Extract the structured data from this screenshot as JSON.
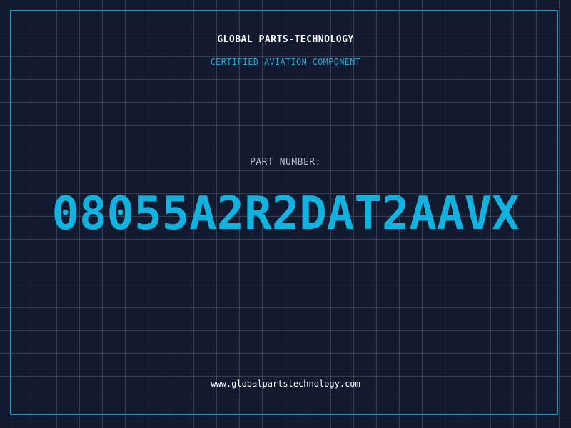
{
  "header": {
    "company_name": "GLOBAL PARTS-TECHNOLOGY",
    "tagline": "CERTIFIED AVIATION COMPONENT"
  },
  "part": {
    "label": "PART NUMBER:",
    "number": "08055A2R2DAT2AAVX"
  },
  "footer": {
    "website": "www.globalpartstechnology.com"
  },
  "colors": {
    "background": "#111a2e",
    "grid": "#2a6e82",
    "frame": "#1597b8",
    "accent": "#10b3df",
    "tagline": "#2aa7d1",
    "label": "#b8c0cc",
    "text": "#ffffff"
  }
}
